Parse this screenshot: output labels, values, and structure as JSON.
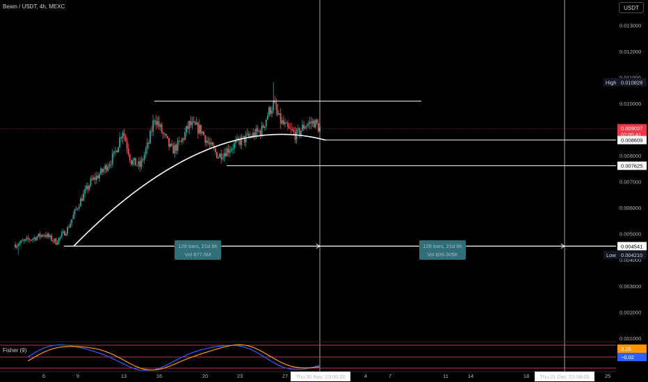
{
  "header": {
    "title": "Beam / USDT, 4h, MEXC",
    "currency": "USDT"
  },
  "colors": {
    "up": "#26a69a",
    "down": "#ef5350",
    "background": "#000000",
    "line": "#ffffff",
    "measure_box": "#2f6f78",
    "current_price": "#f23645",
    "high_tag": "#2962ff",
    "fisher_orange": "#ff9800",
    "fisher_blue": "#2962ff",
    "fisher_band": "#ff4d6d"
  },
  "price_axis": {
    "ticks": [
      "0.013000",
      "0.012000",
      "0.011000",
      "0.010000",
      "0.008000",
      "0.007000",
      "0.006000",
      "0.005000",
      "0.004000",
      "0.003000",
      "0.002000",
      "0.001000"
    ],
    "tags": {
      "high_label": "High",
      "high_value": "0.010828",
      "current_price": "0.009037",
      "countdown": "02:05:41",
      "curve_end": "0.008609",
      "support": "0.007625",
      "base": "0.004541",
      "low_label": "Low",
      "low_value": "0.004210"
    }
  },
  "time_axis": {
    "ticks": [
      "6",
      "9",
      "13",
      "16",
      "20",
      "23",
      "27",
      "4",
      "7",
      "11",
      "14",
      "18",
      "25"
    ],
    "cursor_left": "Thu 30 Nov '23   00:00",
    "cursor_right": "Thu 21 Dec '23   08:00"
  },
  "measures": [
    {
      "line1": "128 bars, 21d 8h",
      "line2": "Vol 877.5M"
    },
    {
      "line1": "128 bars, 21d 8h",
      "line2": "Vol 839.305K"
    }
  ],
  "indicator": {
    "title": "Fisher (9)",
    "value_1": "0.25",
    "value_2": "−0.02"
  },
  "chart_data": {
    "type": "candlestick",
    "title": "Beam / USDT, 4h, MEXC",
    "ylim": [
      0,
      0.0135
    ],
    "y_scale": "linear",
    "grid": false,
    "price_anchors": [
      [
        0,
        0.0046
      ],
      [
        10,
        0.0048
      ],
      [
        20,
        0.005
      ],
      [
        28,
        0.0047
      ],
      [
        36,
        0.0052
      ],
      [
        44,
        0.0062
      ],
      [
        52,
        0.007
      ],
      [
        60,
        0.0074
      ],
      [
        68,
        0.008
      ],
      [
        74,
        0.009
      ],
      [
        80,
        0.0078
      ],
      [
        86,
        0.0076
      ],
      [
        92,
        0.0085
      ],
      [
        96,
        0.0095
      ],
      [
        102,
        0.0088
      ],
      [
        108,
        0.0082
      ],
      [
        114,
        0.0085
      ],
      [
        120,
        0.0092
      ],
      [
        128,
        0.009
      ],
      [
        134,
        0.0084
      ],
      [
        140,
        0.008
      ],
      [
        148,
        0.0083
      ],
      [
        156,
        0.0086
      ],
      [
        164,
        0.0088
      ],
      [
        170,
        0.009
      ],
      [
        174,
        0.0096
      ],
      [
        178,
        0.01
      ],
      [
        182,
        0.0094
      ],
      [
        188,
        0.009
      ],
      [
        194,
        0.0088
      ],
      [
        200,
        0.0092
      ],
      [
        206,
        0.0093
      ],
      [
        210,
        0.00904
      ]
    ],
    "levels": {
      "high": 0.010828,
      "resistance_line": 0.0101,
      "curve_end": 0.008609,
      "support": 0.007625,
      "base": 0.004541,
      "low": 0.00421,
      "current": 0.009037
    },
    "fisher": {
      "name": "Fisher (9)",
      "latest": [
        0.25,
        -0.02
      ]
    }
  }
}
